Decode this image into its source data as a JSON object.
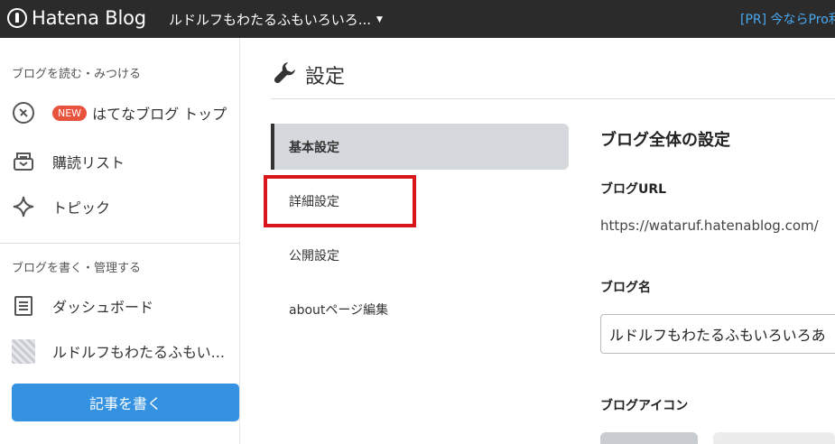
{
  "topbar": {
    "logo_text": "Hatena Blog",
    "blog_name": "ルドルフもわたるふもいろいろ...",
    "promo": "[PR] 今ならPro利用"
  },
  "sidebar": {
    "read_heading": "ブログを読む・みつける",
    "new_badge": "NEW",
    "top_label": "はてなブログ トップ",
    "subscribe_label": "購読リスト",
    "topic_label": "トピック",
    "write_heading": "ブログを書く・管理する",
    "dashboard_label": "ダッシュボード",
    "blog_label": "ルドルフもわたるふもい...",
    "write_button": "記事を書く"
  },
  "page": {
    "title": "設定"
  },
  "settings_nav": {
    "items": [
      "基本設定",
      "詳細設定",
      "公開設定",
      "aboutページ編集"
    ]
  },
  "content": {
    "heading": "ブログ全体の設定",
    "url_label": "ブログURL",
    "url_value": "https://wataruf.hatenablog.com/",
    "name_label": "ブログ名",
    "name_value": "ルドルフもわたるふもいろいろあ",
    "icon_label": "ブログアイコン"
  },
  "colors": {
    "accent": "#3492e0",
    "highlight": "#d7151b",
    "badge": "#e8533e"
  }
}
